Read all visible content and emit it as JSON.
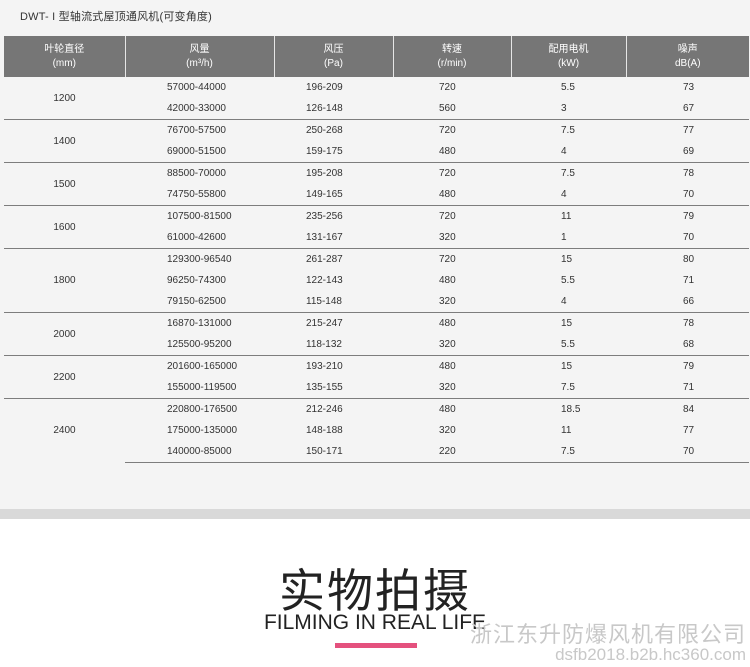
{
  "title": "DWT- I 型轴流式屋顶通风机(可变角度)",
  "headers": [
    {
      "l1": "叶轮直径",
      "l2": "(mm)"
    },
    {
      "l1": "风量",
      "l2": "(m³/h)"
    },
    {
      "l1": "风压",
      "l2": "(Pa)"
    },
    {
      "l1": "转速",
      "l2": "(r/min)"
    },
    {
      "l1": "配用电机",
      "l2": "(kW)"
    },
    {
      "l1": "噪声",
      "l2": "dB(A)"
    }
  ],
  "groups": [
    {
      "diameter": "1200",
      "rows": [
        {
          "flow": "57000-44000",
          "pressure": "196-209",
          "speed": "720",
          "motor": "5.5",
          "noise": "73"
        },
        {
          "flow": "42000-33000",
          "pressure": "126-148",
          "speed": "560",
          "motor": "3",
          "noise": "67"
        }
      ]
    },
    {
      "diameter": "1400",
      "rows": [
        {
          "flow": "76700-57500",
          "pressure": "250-268",
          "speed": "720",
          "motor": "7.5",
          "noise": "77"
        },
        {
          "flow": "69000-51500",
          "pressure": "159-175",
          "speed": "480",
          "motor": "4",
          "noise": "69"
        }
      ]
    },
    {
      "diameter": "1500",
      "rows": [
        {
          "flow": "88500-70000",
          "pressure": "195-208",
          "speed": "720",
          "motor": "7.5",
          "noise": "78"
        },
        {
          "flow": "74750-55800",
          "pressure": "149-165",
          "speed": "480",
          "motor": "4",
          "noise": "70"
        }
      ]
    },
    {
      "diameter": "1600",
      "rows": [
        {
          "flow": "107500-81500",
          "pressure": "235-256",
          "speed": "720",
          "motor": "11",
          "noise": "79"
        },
        {
          "flow": "61000-42600",
          "pressure": "131-167",
          "speed": "320",
          "motor": "1",
          "noise": "70"
        }
      ]
    },
    {
      "diameter": "1800",
      "rows": [
        {
          "flow": "129300-96540",
          "pressure": "261-287",
          "speed": "720",
          "motor": "15",
          "noise": "80"
        },
        {
          "flow": "96250-74300",
          "pressure": "122-143",
          "speed": "480",
          "motor": "5.5",
          "noise": "71"
        },
        {
          "flow": "79150-62500",
          "pressure": "115-148",
          "speed": "320",
          "motor": "4",
          "noise": "66"
        }
      ]
    },
    {
      "diameter": "2000",
      "rows": [
        {
          "flow": "16870-131000",
          "pressure": "215-247",
          "speed": "480",
          "motor": "15",
          "noise": "78"
        },
        {
          "flow": "125500-95200",
          "pressure": "118-132",
          "speed": "320",
          "motor": "5.5",
          "noise": "68"
        }
      ]
    },
    {
      "diameter": "2200",
      "rows": [
        {
          "flow": "201600-165000",
          "pressure": "193-210",
          "speed": "480",
          "motor": "15",
          "noise": "79"
        },
        {
          "flow": "155000-119500",
          "pressure": "135-155",
          "speed": "320",
          "motor": "7.5",
          "noise": "71"
        }
      ]
    },
    {
      "diameter": "2400",
      "rows": [
        {
          "flow": "220800-176500",
          "pressure": "212-246",
          "speed": "480",
          "motor": "18.5",
          "noise": "84"
        },
        {
          "flow": "175000-135000",
          "pressure": "148-188",
          "speed": "320",
          "motor": "11",
          "noise": "77"
        },
        {
          "flow": "140000-85000",
          "pressure": "150-171",
          "speed": "220",
          "motor": "7.5",
          "noise": "70"
        }
      ]
    }
  ],
  "photo_heading": "实物拍摄",
  "photo_subheading": "FILMING IN REAL LIFE",
  "watermark_company": "浙江东升防爆风机有限公司",
  "watermark_url": "dsfb2018.b2b.hc360.com",
  "colors": {
    "header_bg": "#767676",
    "accent_bar": "#e4517e"
  }
}
